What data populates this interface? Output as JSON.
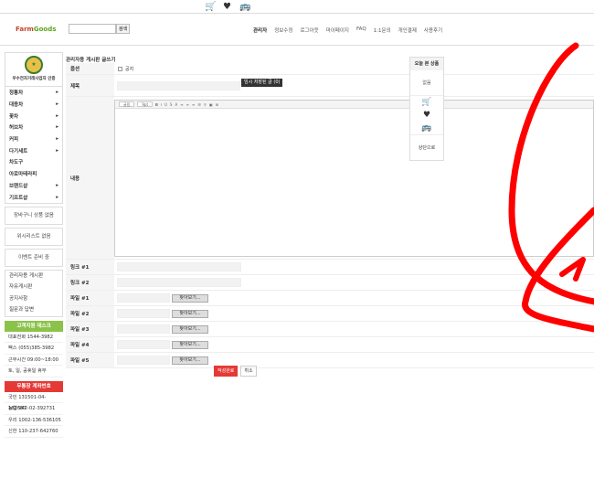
{
  "logo": {
    "part1": "Farm",
    "part2": "Goods"
  },
  "search": {
    "button": "검색",
    "placeholder": ""
  },
  "topnav": [
    "관리자",
    "정보수정",
    "로그아웃",
    "마이페이지",
    "FAQ",
    "1:1문의",
    "개인결제",
    "사용후기"
  ],
  "sidebar": {
    "badge": "우수전자거래사업자 인증",
    "categories": [
      {
        "label": "정통차",
        "arrow": true
      },
      {
        "label": "대용차",
        "arrow": true
      },
      {
        "label": "꽃차",
        "arrow": true
      },
      {
        "label": "허브차",
        "arrow": true
      },
      {
        "label": "커피",
        "arrow": true
      },
      {
        "label": "다기세트",
        "arrow": true
      },
      {
        "label": "차도구",
        "arrow": false
      },
      {
        "label": "아로마테라피",
        "arrow": false
      },
      {
        "label": "브랜드샵",
        "arrow": true
      },
      {
        "label": "기프트샵",
        "arrow": true
      }
    ],
    "cart": "장바구니 상품 없음",
    "wish": "위시리스트 없음",
    "event": "이벤트 준비 중",
    "boards": [
      "관리자용 게시판",
      "자유게시판",
      "공지사항",
      "질문과 답변"
    ],
    "cs_title": "고객지원 데스크",
    "cs_info": [
      "대표전화 1544-3982",
      "팩스 (055)385-3982",
      "근무시간 09:00~18:00",
      "토, 일, 공휴일 휴무"
    ],
    "bank_title": "무통장 계좌번호",
    "bank_info": [
      "국민 131501-04-182687",
      "농협 942-02-392731",
      "우리 1002-136-536105",
      "신한 110-237-642760"
    ]
  },
  "page_title": "관리자용 게시판 글쓰기",
  "form": {
    "option_label": "옵션",
    "notice_label": "공지",
    "subject_label": "제목",
    "autosave_tooltip": "임시 저장된 글 (0)",
    "content_label": "내용",
    "toolbar_font": "굴림",
    "toolbar_size": "9pt",
    "links": [
      "링크 #1",
      "링크 #2"
    ],
    "files": [
      "파일 #1",
      "파일 #2",
      "파일 #3",
      "파일 #4",
      "파일 #5"
    ],
    "file_button": "찾아보기..."
  },
  "actions": {
    "submit": "작성완료",
    "cancel": "취소"
  },
  "recent": {
    "title": "오늘 본 상품",
    "empty": "없음",
    "up": "상단으로"
  },
  "colors": {
    "accent_red": "#e53935",
    "accent_green": "#8bc34a",
    "scribble": "#ff0000"
  }
}
